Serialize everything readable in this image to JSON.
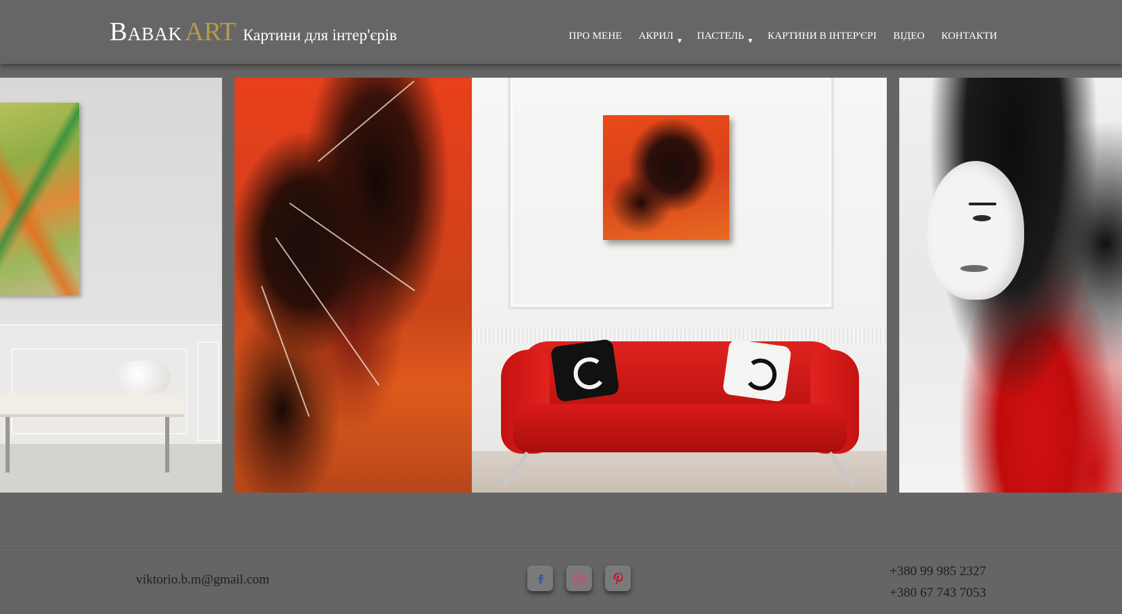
{
  "header": {
    "logo_babak": "Babak",
    "logo_art": "ART",
    "tagline": "Картини для інтер'єрів"
  },
  "nav": [
    {
      "label": "ПРО МЕНЕ",
      "has_submenu": false
    },
    {
      "label": "АКРИЛ",
      "has_submenu": true
    },
    {
      "label": "ПАСТЕЛЬ",
      "has_submenu": true
    },
    {
      "label": "КАРТИНИ В ІНТЕР'ЄРІ",
      "has_submenu": false
    },
    {
      "label": "ВІДЕО",
      "has_submenu": false
    },
    {
      "label": "КОНТАКТИ",
      "has_submenu": false
    }
  ],
  "slider": {
    "slides": [
      "abstract-green-orange-interior",
      "red-butterfly-painting",
      "red-sofa-interior",
      "woman-portrait-painting"
    ]
  },
  "footer": {
    "email": "viktorio.b.m@gmail.com",
    "phones": [
      "+380 99 985 2327",
      "+380 67 743 7053"
    ],
    "socials": [
      {
        "name": "facebook-icon",
        "color": "#3b5998"
      },
      {
        "name": "instagram-icon",
        "color": "#d6457a"
      },
      {
        "name": "pinterest-icon",
        "color": "#c8102e"
      }
    ]
  },
  "colors": {
    "background": "#656565",
    "logo_accent": "#b89a4a",
    "text_light": "#ffffff",
    "text_dark": "#1e1e1e"
  }
}
